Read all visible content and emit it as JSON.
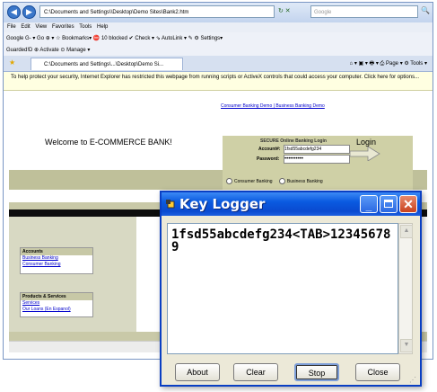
{
  "browser": {
    "address": "C:\\Documents and Settings\\\\Desktop\\Demo Sites\\Bank2.htm",
    "search_placeholder": "Google",
    "menu": [
      "File",
      "Edit",
      "View",
      "Favorites",
      "Tools",
      "Help"
    ],
    "google_toolbar": "Google  G-  ▾ Go ⊕ ▾  ☆ Bookmarks▾  ⛔ 10 blocked  ✔ Check ▾  ⇘ AutoLink ▾  ✎  ⚙ Settings▾",
    "info_row": "Guarded!D   ⊕ Activate   ⊙ Manage ▾",
    "tab_title": "C:\\Documents and Settings\\...\\Desktop\\Demo Si...",
    "tab_tools": "⌂ ▾  ▣ ▾  🖶 ▾  ⎙ Page ▾  ⚙ Tools ▾",
    "infobar": "To help protect your security, Internet Explorer has restricted this webpage from running scripts or ActiveX controls that could access your computer. Click here for options..."
  },
  "page": {
    "top_links": "Consumer Banking Demo | Business Banking Demo",
    "welcome": "Welcome to E-COMMERCE BANK!",
    "login_header": "SECURE Online Banking Login",
    "account_label": "Account#:",
    "account_value": "1fsd55abcdefg234",
    "password_label": "Password:",
    "password_value": "••••••••••",
    "login_label": "Login",
    "radio_consumer": "Consumer Banking",
    "radio_business": "Business Banking",
    "accounts_header": "Accounts",
    "accounts_items": [
      "Business Banking",
      "Consumer Banking"
    ],
    "products_header": "Products & Services",
    "products_items": [
      "Services",
      "Our Loans (En Espanol)"
    ]
  },
  "keylogger": {
    "title": "Key Logger",
    "log_text": "1fsd55abcdefg234<TAB>123456789",
    "buttons": {
      "about": "About",
      "clear": "Clear",
      "stop": "Stop",
      "close": "Close"
    }
  },
  "colors": {
    "xp_title_blue": "#0a5ae0",
    "close_red": "#c9421e",
    "login_tan": "#cfd0a6",
    "link_blue": "#0000cc"
  }
}
